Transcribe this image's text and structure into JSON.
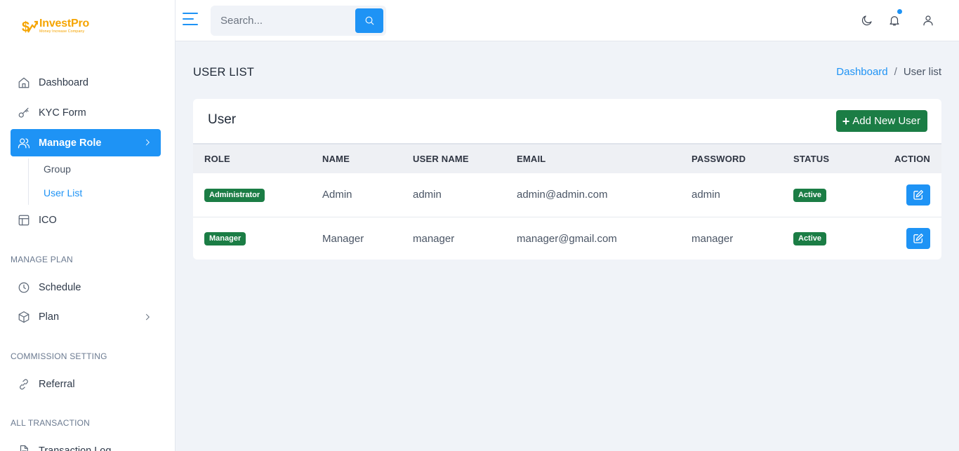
{
  "brand": {
    "name": "InvestPro",
    "tagline": "Money Increase Company",
    "color": "#f5a400"
  },
  "sidebar": {
    "items": [
      {
        "label": "Dashboard",
        "icon": "home-icon"
      },
      {
        "label": "KYC Form",
        "icon": "key-icon"
      },
      {
        "label": "Manage Role",
        "icon": "users-icon",
        "active": true,
        "has_submenu": true
      },
      {
        "label": "ICO",
        "icon": "layout-icon"
      },
      {
        "label": "Schedule",
        "icon": "clock-icon"
      },
      {
        "label": "Plan",
        "icon": "box-icon",
        "has_submenu": true
      },
      {
        "label": "Referral",
        "icon": "link-icon"
      },
      {
        "label": "Transaction Log",
        "icon": "file-icon"
      }
    ],
    "submenu": [
      {
        "label": "Group"
      },
      {
        "label": "User List",
        "current": true
      }
    ],
    "sections": [
      "MANAGE PLAN",
      "COMMISSION SETTING",
      "ALL TRANSACTION"
    ]
  },
  "topbar": {
    "search_placeholder": "Search...",
    "icons": [
      "menu-icon",
      "search-icon",
      "moon-icon",
      "bell-icon",
      "user-icon"
    ]
  },
  "page": {
    "title": "USER LIST",
    "breadcrumb": {
      "link": "Dashboard",
      "separator": "/",
      "current": "User list"
    }
  },
  "card": {
    "title": "User",
    "add_button": "Add New User",
    "columns": [
      "ROLE",
      "NAME",
      "USER NAME",
      "EMAIL",
      "PASSWORD",
      "STATUS",
      "ACTION"
    ],
    "rows": [
      {
        "role": "Administrator",
        "name": "Admin",
        "username": "admin",
        "email": "admin@admin.com",
        "password": "admin",
        "status": "Active"
      },
      {
        "role": "Manager",
        "name": "Manager",
        "username": "manager",
        "email": "manager@gmail.com",
        "password": "manager",
        "status": "Active"
      }
    ]
  },
  "colors": {
    "primary": "#1e93f5",
    "success": "#1b7d45",
    "background": "#f0f3f8"
  }
}
